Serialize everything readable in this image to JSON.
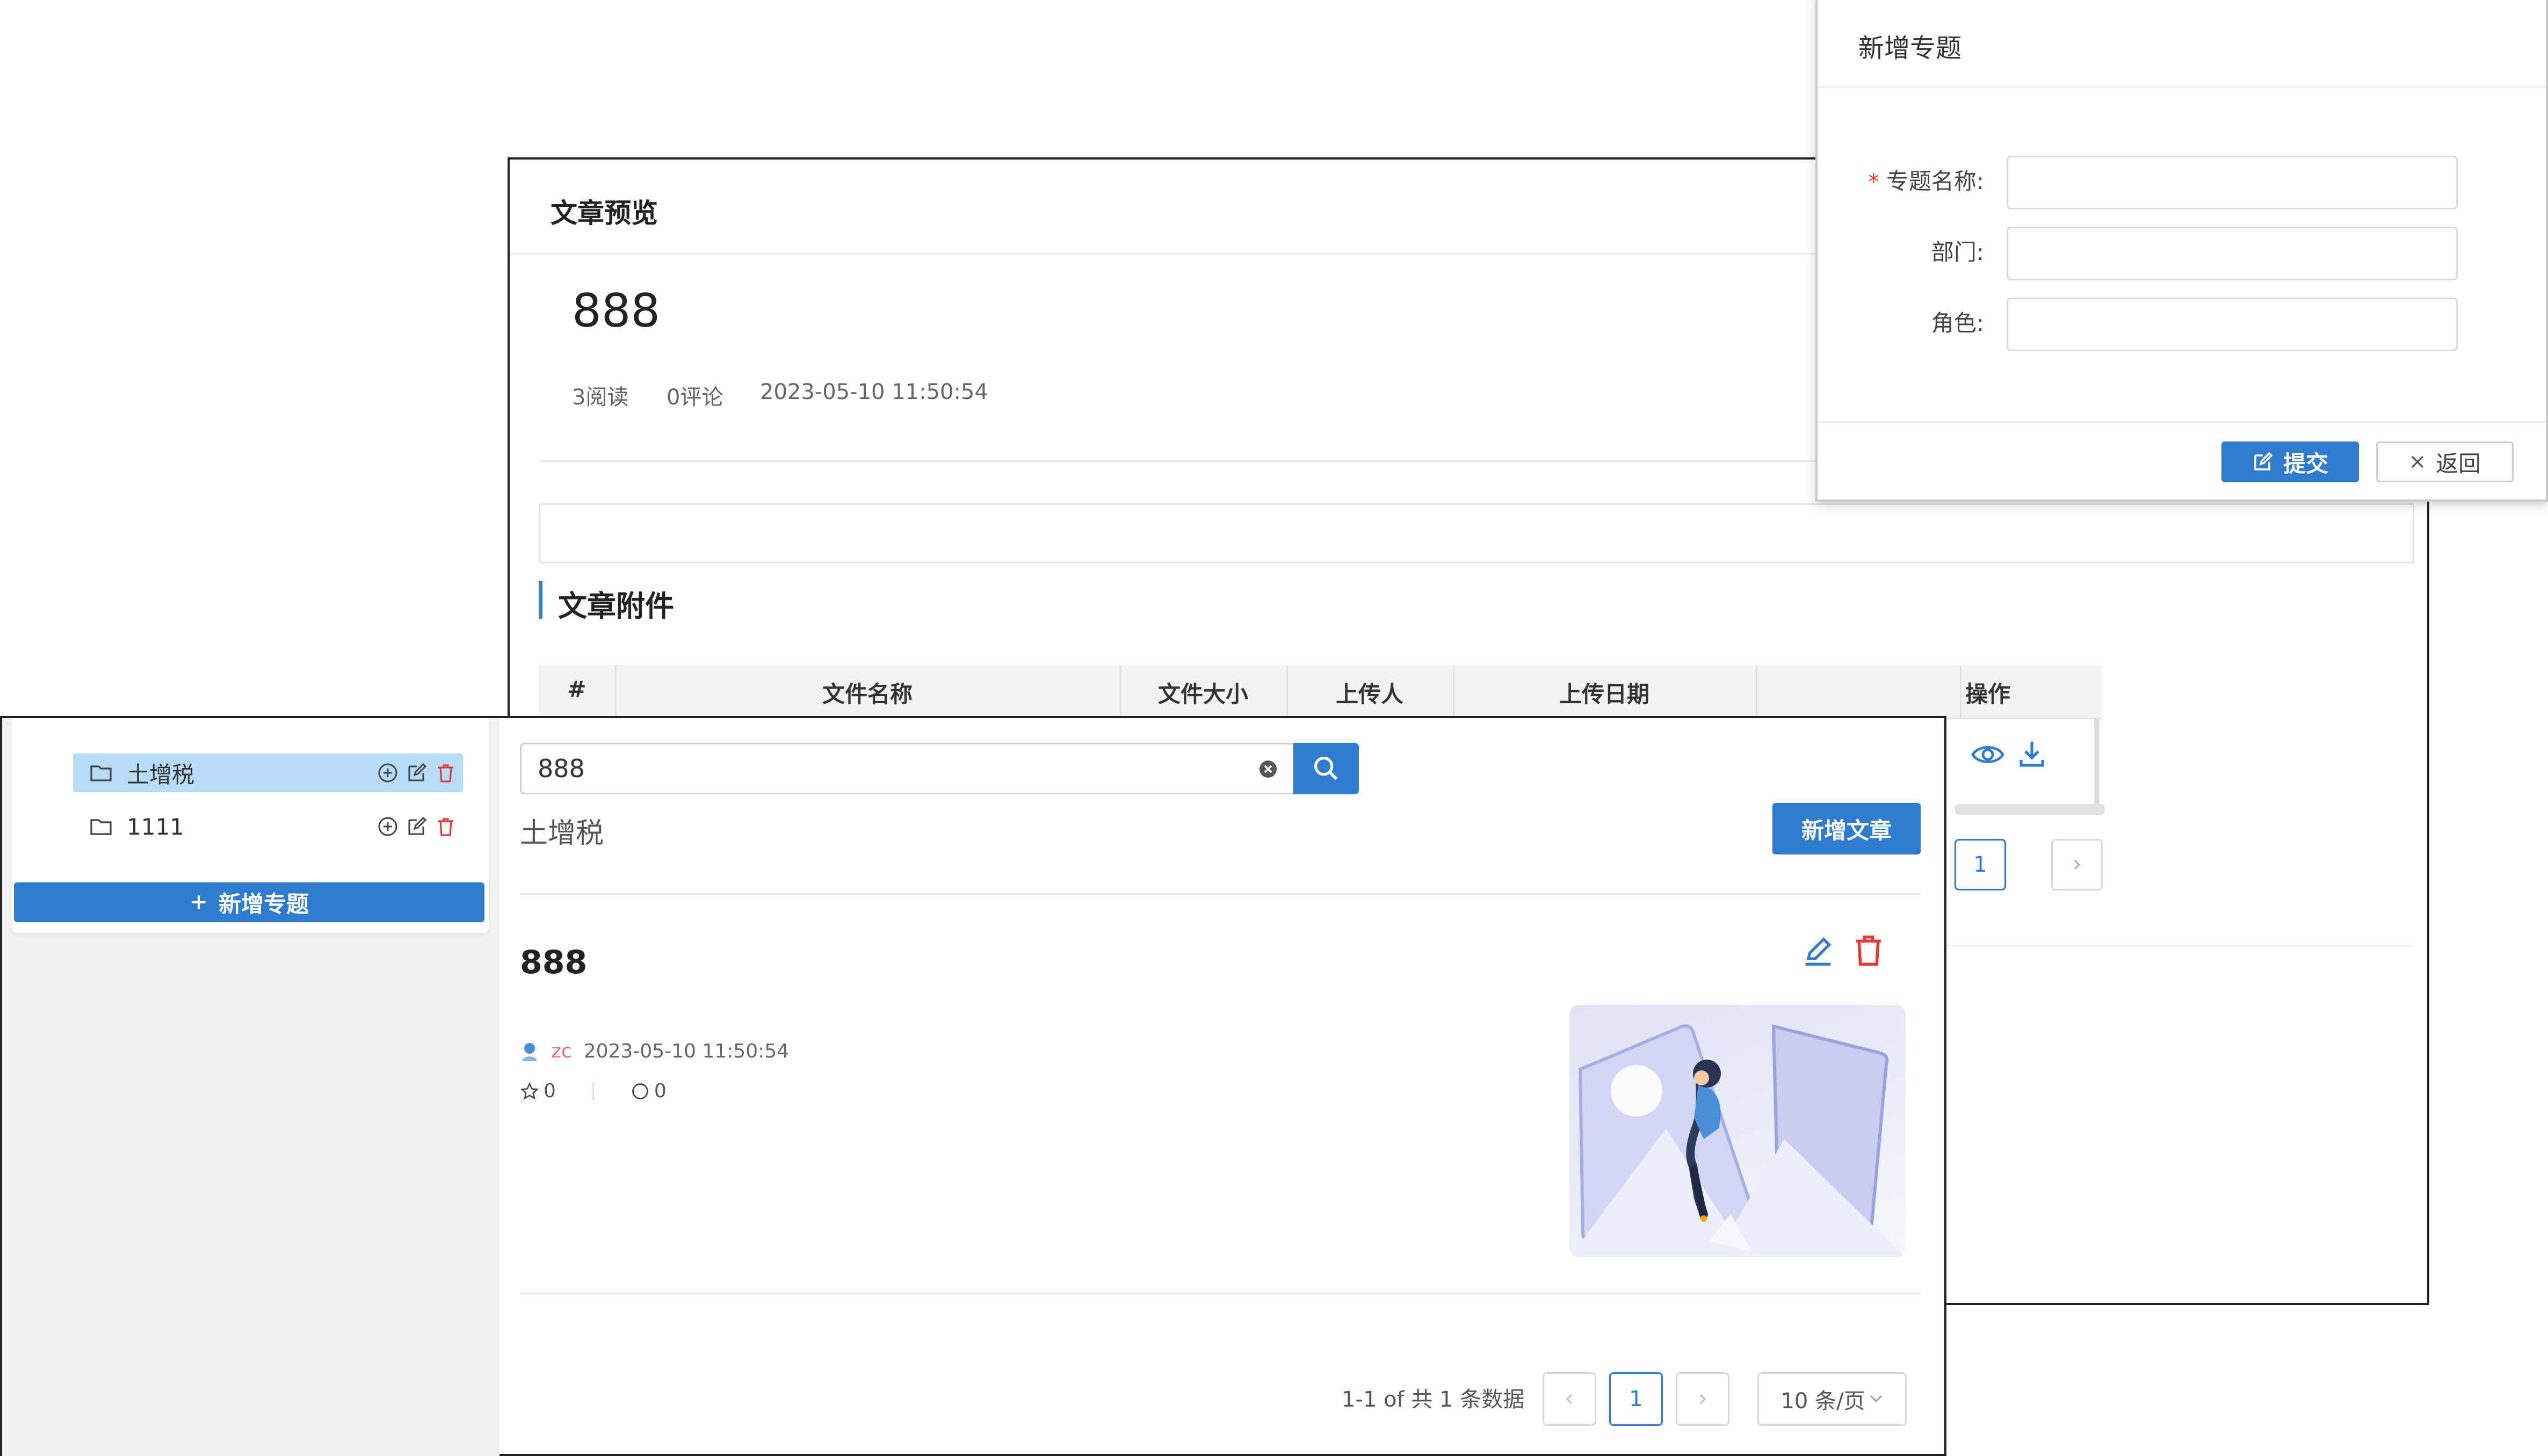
{
  "preview": {
    "title": "文章预览",
    "article_title": "888",
    "reads": "3阅读",
    "comments": "0评论",
    "datetime": "2023-05-10 11:50:54",
    "attachments_title": "文章附件",
    "table_headers": [
      "#",
      "文件名称",
      "文件大小",
      "上传人",
      "上传日期",
      "操作"
    ],
    "row_actions": [
      "eye-icon",
      "download-icon"
    ],
    "pagination": {
      "current": "1"
    }
  },
  "dialog": {
    "title": "新增专题",
    "required_mark": "*",
    "fields": [
      {
        "label": "专题名称:",
        "required": true,
        "value": ""
      },
      {
        "label": "部门:",
        "required": false,
        "value": ""
      },
      {
        "label": "角色:",
        "required": false,
        "value": ""
      }
    ],
    "submit_label": "提交",
    "back_label": "返回"
  },
  "sidebar": {
    "tree": [
      {
        "label": "土增税",
        "selected": true
      },
      {
        "label": "1111",
        "selected": false
      }
    ],
    "add_topic_label": "新增专题"
  },
  "main": {
    "search": {
      "value": "888"
    },
    "topic_name": "土增税",
    "new_article_label": "新增文章",
    "card": {
      "title": "888",
      "author": "zc",
      "datetime": "2023-05-10 11:50:54",
      "stars": "0",
      "comments": "0"
    },
    "pagination": {
      "info": "1-1 of 共 1 条数据",
      "current": "1",
      "page_size": "10 条/页"
    }
  },
  "colors": {
    "primary": "#2f7bd0",
    "selected_bg": "#b7dcf7",
    "danger": "#e53935"
  }
}
